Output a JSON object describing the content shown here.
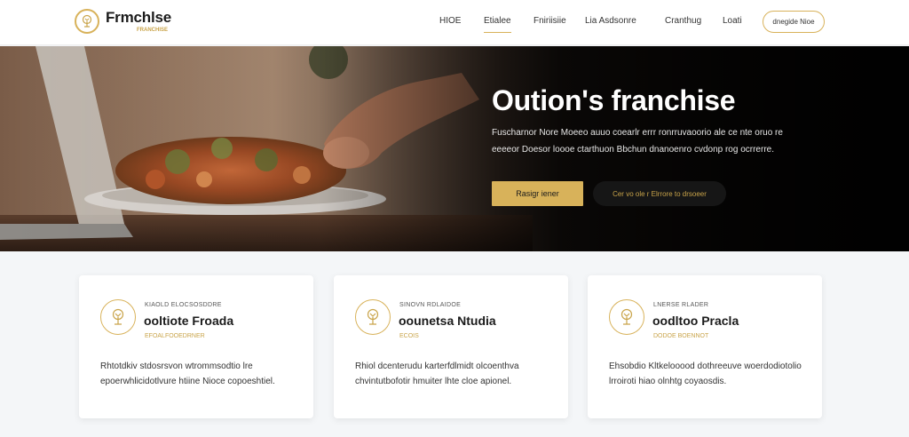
{
  "brand": {
    "name": "Frmchlse",
    "tagline": "FRANCHISE",
    "accent": "#d8b25a",
    "logo_icon": "tree-icon"
  },
  "nav": {
    "items": [
      {
        "label": "HIOE",
        "active": false
      },
      {
        "label": "Etialee",
        "active": true
      },
      {
        "label": "Fniriisiie",
        "active": false
      },
      {
        "label": "Lia Asdsonre",
        "active": false
      },
      {
        "label": "Cranthug",
        "active": false
      },
      {
        "label": "Loati",
        "active": false
      }
    ],
    "cta_label": "dnegide Nioe"
  },
  "hero": {
    "title": "Oution's franchise",
    "description": "Fuscharnor Nore Moeeo auuo coearlr errr ronrruvaoorio ale ce nte oruo re eeeeor Doesor loooe ctarthuon Bbchun dnanoenro cvdonp rog ocrrerre.",
    "primary_button": "Rasigr iener",
    "secondary_button": "Cer vo ole r Elrrore to drsoeer"
  },
  "cards": [
    {
      "icon": "tree-icon",
      "eyebrow": "KIAOLD ELOCSOSDDRE",
      "title": "ooltiote Froada",
      "subtitle": "EFOALFOOEDRNER",
      "body": "Rhtotdkiv stdosrsvon wtrommsodtio lre epoerwhlicidotlvure htiine Nioce copoeshtiel."
    },
    {
      "icon": "tree-icon",
      "eyebrow": "SINOVN RDLAIDOE",
      "title": "oounetsa Ntudia",
      "subtitle": "ECOIS",
      "body": "Rhiol dcenterudu karterfdlmidt olcoenthva chvintutbofotir hmuiter lhte cloe apionel."
    },
    {
      "icon": "tree-icon",
      "eyebrow": "LNERSE RLADER",
      "title": "oodltoo Pracla",
      "subtitle": "DODOE BOENNOT",
      "body": "Ehsobdio Kltkelooood dothreeuve woerdodiotolio lrroiroti hiao olnhtg coyaosdis."
    }
  ]
}
